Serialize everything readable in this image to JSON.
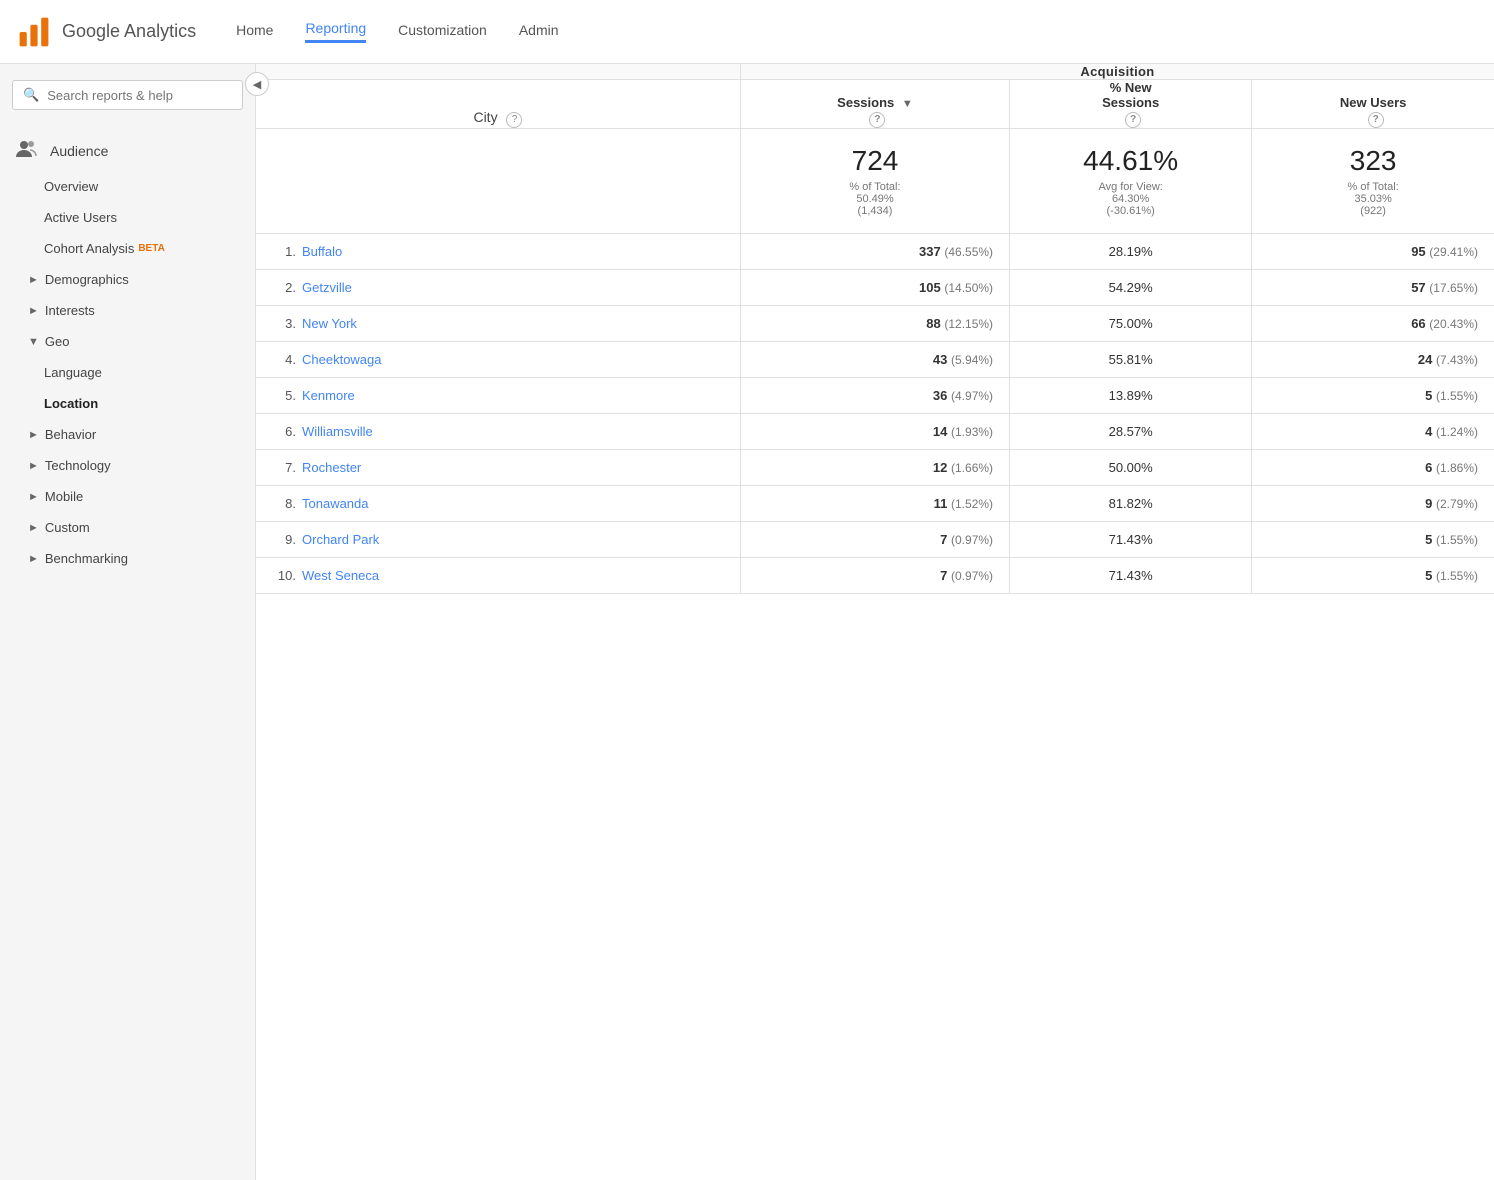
{
  "topnav": {
    "logo_text": "Google Analytics",
    "links": [
      {
        "label": "Home",
        "active": false
      },
      {
        "label": "Reporting",
        "active": true
      },
      {
        "label": "Customization",
        "active": false
      },
      {
        "label": "Admin",
        "active": false
      }
    ]
  },
  "sidebar": {
    "search_placeholder": "Search reports & help",
    "sections": [
      {
        "type": "main",
        "icon": "audience-icon",
        "label": "Audience"
      },
      {
        "type": "sub",
        "label": "Overview",
        "indent": 44,
        "active": false
      },
      {
        "type": "sub",
        "label": "Active Users",
        "indent": 44,
        "active": false
      },
      {
        "type": "cohort",
        "label": "Cohort Analysis",
        "beta": "BETA",
        "indent": 44
      },
      {
        "type": "arrow",
        "label": "Demographics",
        "arrow": "right"
      },
      {
        "type": "arrow",
        "label": "Interests",
        "arrow": "right"
      },
      {
        "type": "arrow",
        "label": "Geo",
        "arrow": "down"
      },
      {
        "type": "geo-sub",
        "label": "Language"
      },
      {
        "type": "geo-sub",
        "label": "Location",
        "active": true
      },
      {
        "type": "arrow",
        "label": "Behavior",
        "arrow": "right"
      },
      {
        "type": "arrow",
        "label": "Technology",
        "arrow": "right"
      },
      {
        "type": "arrow",
        "label": "Mobile",
        "arrow": "right"
      },
      {
        "type": "arrow",
        "label": "Custom",
        "arrow": "right"
      },
      {
        "type": "arrow",
        "label": "Benchmarking",
        "arrow": "right"
      }
    ]
  },
  "table": {
    "acquisition_label": "Acquisition",
    "city_label": "City",
    "columns": [
      {
        "key": "sessions",
        "label": "Sessions",
        "has_sort": true
      },
      {
        "key": "new_sessions",
        "label": "% New\nSessions"
      },
      {
        "key": "new_users",
        "label": "New Users"
      }
    ],
    "summary": {
      "sessions_val": "724",
      "sessions_sub": "% of Total:\n50.49%\n(1,434)",
      "new_sessions_val": "44.61%",
      "new_sessions_sub": "Avg for View:\n64.30%\n(-30.61%)",
      "new_users_val": "323",
      "new_users_sub": "% of Total:\n35.03%\n(922)"
    },
    "rows": [
      {
        "rank": 1,
        "city": "Buffalo",
        "sessions": "337",
        "sessions_pct": "(46.55%)",
        "new_sessions": "28.19%",
        "new_users": "95",
        "new_users_pct": "(29.41%)"
      },
      {
        "rank": 2,
        "city": "Getzville",
        "sessions": "105",
        "sessions_pct": "(14.50%)",
        "new_sessions": "54.29%",
        "new_users": "57",
        "new_users_pct": "(17.65%)"
      },
      {
        "rank": 3,
        "city": "New York",
        "sessions": "88",
        "sessions_pct": "(12.15%)",
        "new_sessions": "75.00%",
        "new_users": "66",
        "new_users_pct": "(20.43%)"
      },
      {
        "rank": 4,
        "city": "Cheektowaga",
        "sessions": "43",
        "sessions_pct": "(5.94%)",
        "new_sessions": "55.81%",
        "new_users": "24",
        "new_users_pct": "(7.43%)"
      },
      {
        "rank": 5,
        "city": "Kenmore",
        "sessions": "36",
        "sessions_pct": "(4.97%)",
        "new_sessions": "13.89%",
        "new_users": "5",
        "new_users_pct": "(1.55%)"
      },
      {
        "rank": 6,
        "city": "Williamsville",
        "sessions": "14",
        "sessions_pct": "(1.93%)",
        "new_sessions": "28.57%",
        "new_users": "4",
        "new_users_pct": "(1.24%)"
      },
      {
        "rank": 7,
        "city": "Rochester",
        "sessions": "12",
        "sessions_pct": "(1.66%)",
        "new_sessions": "50.00%",
        "new_users": "6",
        "new_users_pct": "(1.86%)"
      },
      {
        "rank": 8,
        "city": "Tonawanda",
        "sessions": "11",
        "sessions_pct": "(1.52%)",
        "new_sessions": "81.82%",
        "new_users": "9",
        "new_users_pct": "(2.79%)"
      },
      {
        "rank": 9,
        "city": "Orchard Park",
        "sessions": "7",
        "sessions_pct": "(0.97%)",
        "new_sessions": "71.43%",
        "new_users": "5",
        "new_users_pct": "(1.55%)"
      },
      {
        "rank": 10,
        "city": "West Seneca",
        "sessions": "7",
        "sessions_pct": "(0.97%)",
        "new_sessions": "71.43%",
        "new_users": "5",
        "new_users_pct": "(1.55%)"
      }
    ]
  },
  "colors": {
    "brand_orange": "#e8710a",
    "brand_blue": "#4285f4",
    "active_nav": "#4285f4"
  }
}
